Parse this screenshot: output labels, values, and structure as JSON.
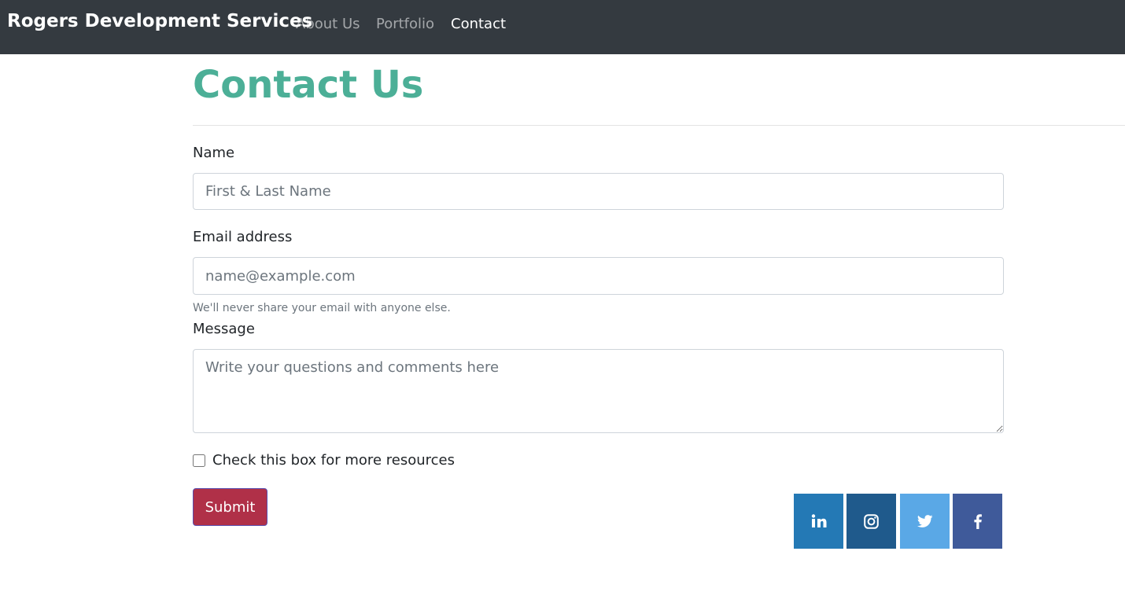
{
  "navbar": {
    "brand": "Rogers Development Services",
    "links": [
      {
        "label": "About Us",
        "active": false
      },
      {
        "label": "Portfolio",
        "active": false
      },
      {
        "label": "Contact",
        "active": true
      }
    ],
    "background": "#343a40"
  },
  "page": {
    "title": "Contact Us",
    "title_color": "#4caf97"
  },
  "form": {
    "name": {
      "label": "Name",
      "placeholder": "First & Last Name",
      "value": ""
    },
    "email": {
      "label": "Email address",
      "placeholder": "name@example.com",
      "value": "",
      "help": "We'll never share your email with anyone else."
    },
    "message": {
      "label": "Message",
      "placeholder": "Write your questions and comments here",
      "value": ""
    },
    "checkbox": {
      "label": "Check this box for more resources",
      "checked": false
    },
    "submit": {
      "label": "Submit",
      "color": "#b03048"
    }
  },
  "social": [
    {
      "name": "linkedin-icon",
      "color": "#2479b5"
    },
    {
      "name": "instagram-icon",
      "color": "#1f5a8c"
    },
    {
      "name": "twitter-icon",
      "color": "#5aa8e6"
    },
    {
      "name": "facebook-icon",
      "color": "#3f5a9a"
    }
  ]
}
